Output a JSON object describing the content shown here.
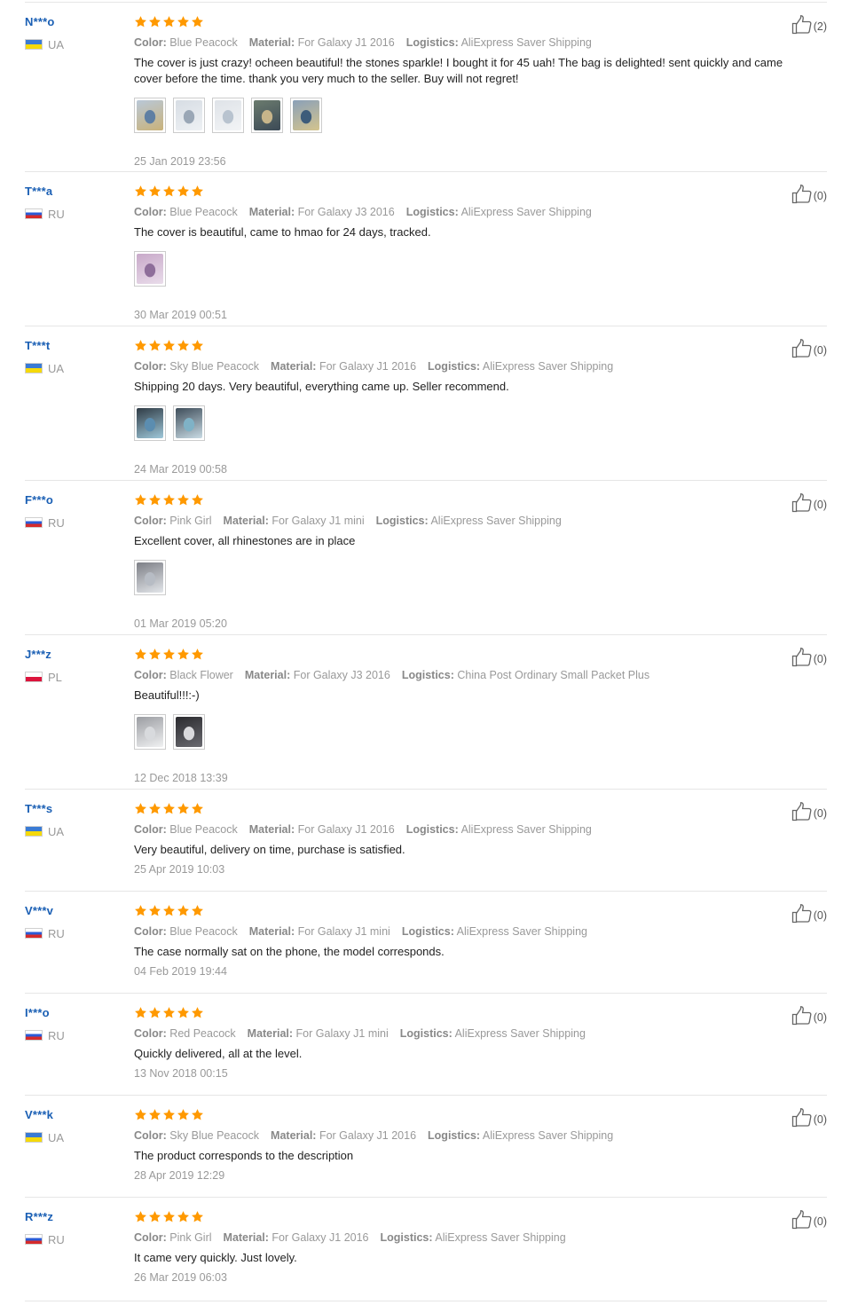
{
  "reviews": [
    {
      "user": "N***o",
      "country": "UA",
      "flag": "ua",
      "rating": 5,
      "color_label": "Color:",
      "color": "Blue Peacock",
      "material_label": "Material:",
      "material": "For Galaxy J1 2016",
      "logistics_label": "Logistics:",
      "logistics": "AliExpress Saver Shipping",
      "text": "The cover is just crazy! ocheen beautiful! the stones sparkle! I bought it for 45 uah! The bag is delighted! sent quickly and came cover before the time. thank you very much to the seller. Buy will not regret!",
      "photos": 5,
      "date": "25 Jan 2019 23:56",
      "likes": "(2)"
    },
    {
      "user": "T***a",
      "country": "RU",
      "flag": "ru",
      "rating": 5,
      "color_label": "Color:",
      "color": "Blue Peacock",
      "material_label": "Material:",
      "material": "For Galaxy J3 2016",
      "logistics_label": "Logistics:",
      "logistics": "AliExpress Saver Shipping",
      "text": "The cover is beautiful, came to hmao for 24 days, tracked.",
      "photos": 1,
      "date": "30 Mar 2019 00:51",
      "likes": "(0)"
    },
    {
      "user": "T***t",
      "country": "UA",
      "flag": "ua",
      "rating": 5,
      "color_label": "Color:",
      "color": "Sky Blue Peacock",
      "material_label": "Material:",
      "material": "For Galaxy J1 2016",
      "logistics_label": "Logistics:",
      "logistics": "AliExpress Saver Shipping",
      "text": "Shipping 20 days. Very beautiful, everything came up. Seller recommend.",
      "photos": 2,
      "date": "24 Mar 2019 00:58",
      "likes": "(0)"
    },
    {
      "user": "F***o",
      "country": "RU",
      "flag": "ru",
      "rating": 5,
      "color_label": "Color:",
      "color": "Pink Girl",
      "material_label": "Material:",
      "material": "For Galaxy J1 mini",
      "logistics_label": "Logistics:",
      "logistics": "AliExpress Saver Shipping",
      "text": "Excellent cover, all rhinestones are in place",
      "photos": 1,
      "date": "01 Mar 2019 05:20",
      "likes": "(0)"
    },
    {
      "user": "J***z",
      "country": "PL",
      "flag": "pl",
      "rating": 5,
      "color_label": "Color:",
      "color": "Black Flower",
      "material_label": "Material:",
      "material": "For Galaxy J3 2016",
      "logistics_label": "Logistics:",
      "logistics": "China Post Ordinary Small Packet Plus",
      "text": "Beautiful!!!:-)",
      "photos": 2,
      "date": "12 Dec 2018 13:39",
      "likes": "(0)"
    },
    {
      "user": "T***s",
      "country": "UA",
      "flag": "ua",
      "rating": 5,
      "color_label": "Color:",
      "color": "Blue Peacock",
      "material_label": "Material:",
      "material": "For Galaxy J1 2016",
      "logistics_label": "Logistics:",
      "logistics": "AliExpress Saver Shipping",
      "text": "Very beautiful, delivery on time, purchase is satisfied.",
      "photos": 0,
      "date": "25 Apr 2019 10:03",
      "likes": "(0)"
    },
    {
      "user": "V***v",
      "country": "RU",
      "flag": "ru",
      "rating": 5,
      "color_label": "Color:",
      "color": "Blue Peacock",
      "material_label": "Material:",
      "material": "For Galaxy J1 mini",
      "logistics_label": "Logistics:",
      "logistics": "AliExpress Saver Shipping",
      "text": "The case normally sat on the phone, the model corresponds.",
      "photos": 0,
      "date": "04 Feb 2019 19:44",
      "likes": "(0)"
    },
    {
      "user": "I***o",
      "country": "RU",
      "flag": "ru",
      "rating": 5,
      "color_label": "Color:",
      "color": "Red Peacock",
      "material_label": "Material:",
      "material": "For Galaxy J1 mini",
      "logistics_label": "Logistics:",
      "logistics": "AliExpress Saver Shipping",
      "text": "Quickly delivered, all at the level.",
      "photos": 0,
      "date": "13 Nov 2018 00:15",
      "likes": "(0)"
    },
    {
      "user": "V***k",
      "country": "UA",
      "flag": "ua",
      "rating": 5,
      "color_label": "Color:",
      "color": "Sky Blue Peacock",
      "material_label": "Material:",
      "material": "For Galaxy J1 2016",
      "logistics_label": "Logistics:",
      "logistics": "AliExpress Saver Shipping",
      "text": "The product corresponds to the description",
      "photos": 0,
      "date": "28 Apr 2019 12:29",
      "likes": "(0)"
    },
    {
      "user": "R***z",
      "country": "RU",
      "flag": "ru",
      "rating": 5,
      "color_label": "Color:",
      "color": "Pink Girl",
      "material_label": "Material:",
      "material": "For Galaxy J1 2016",
      "logistics_label": "Logistics:",
      "logistics": "AliExpress Saver Shipping",
      "text": "It came very quickly. Just lovely.",
      "photos": 0,
      "date": "26 Mar 2019 06:03",
      "likes": "(0)"
    }
  ],
  "colors": {
    "user_link": "#1a5fb4",
    "star": "#ff9900",
    "meta": "#999999"
  }
}
